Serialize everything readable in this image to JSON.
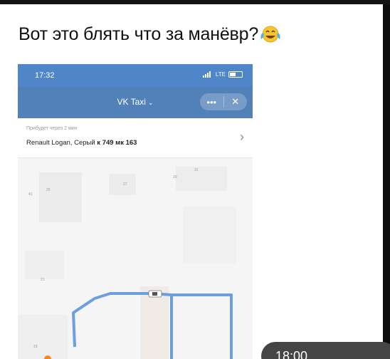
{
  "post": {
    "text": "Вот это блять что за манёвр?",
    "emoji": "face-with-tears-of-joy-emoji"
  },
  "phone": {
    "status_time": "17:32",
    "status_network": "LTE",
    "app_title": "VK Taxi",
    "menu_label": "•••",
    "close_label": "✕",
    "arrival_text": "Прибудет через 2 мин",
    "car_description": "Renault Logan, Серый",
    "plate": "к 749 мк 163",
    "map_labels": [
      "27",
      "29",
      "31",
      "41",
      "25",
      "21",
      "19"
    ]
  },
  "overlay": {
    "message_time": "18:00"
  },
  "colors": {
    "status_bar": "#4f86c9",
    "nav_bar": "#5181b8",
    "route": "#6d9ee2",
    "overlay_bubble": "#454545"
  }
}
